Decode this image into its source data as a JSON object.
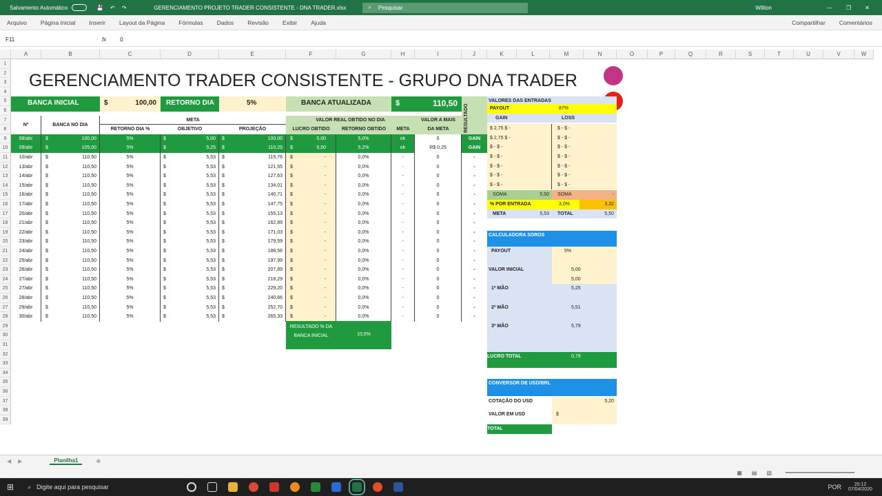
{
  "titlebar": {
    "autosave": "Salvamento Automático",
    "file_title": "GERENCIAMENTO PROJETO TRADER CONSISTENTE - DNA TRADER.xlsx",
    "search_placeholder": "Pesquisar",
    "user": "Willion"
  },
  "ribbon": {
    "tabs": [
      "Arquivo",
      "Página Inicial",
      "Inserir",
      "Layout da Página",
      "Fórmulas",
      "Dados",
      "Revisão",
      "Exibir",
      "Ajuda"
    ],
    "share": "Compartilhar",
    "comments": "Comentários"
  },
  "formulabar": {
    "cellref": "F11",
    "value": "0"
  },
  "columns": [
    "A",
    "B",
    "C",
    "D",
    "E",
    "F",
    "G",
    "H",
    "I",
    "J",
    "K",
    "L",
    "M",
    "N",
    "O",
    "P",
    "Q",
    "R",
    "S",
    "T",
    "U",
    "V",
    "W"
  ],
  "sheet": {
    "title": "GERENCIAMENTO TRADER CONSISTENTE - GRUPO DNA TRADER",
    "banca_inicial_label": "BANCA INICIAL",
    "banca_inicial_cur": "$",
    "banca_inicial_value": "100,00",
    "retorno_label": "RETORNO DIA",
    "retorno_value": "5%",
    "banca_atual_label": "BANCA ATUALIZADA",
    "banca_atual_cur": "$",
    "banca_atual_value": "110,50",
    "resultado_label": "RESULTADO",
    "h_num": "Nº",
    "h_banca": "BANCA NO DIA",
    "h_meta": "META",
    "h_retorno": "RETORNO DIA %",
    "h_objetivo": "OBJETIVO",
    "h_projecao": "PROJEÇÃO",
    "h_valor_real": "VALOR REAL OBTIDO NO DIA",
    "h_lucro": "LUCRO OBTIDO",
    "h_ret_obtido": "RETORNO OBTIDO",
    "h_meta2": "META",
    "h_valor_mais": "VALOR A MAIS",
    "h_da_meta": "DA META",
    "rows": [
      {
        "n": "9",
        "date": "08/abr",
        "banca": "100,00",
        "ret": "5%",
        "obj": "5,00",
        "proj": "100,00",
        "lucro": "5,00",
        "retob": "5,0%",
        "meta": "ok",
        "mais": "0",
        "res": "GAIN"
      },
      {
        "n": "10",
        "date": "09/abr",
        "banca": "105,00",
        "ret": "5%",
        "obj": "5,25",
        "proj": "110,25",
        "lucro": "5,50",
        "retob": "5,2%",
        "meta": "ok",
        "mais": "R$ 0,25",
        "res": "GAIN"
      },
      {
        "n": "11",
        "date": "10/abr",
        "banca": "110,50",
        "ret": "5%",
        "obj": "5,53",
        "proj": "115,76",
        "lucro": "-",
        "retob": "0,0%",
        "meta": "-",
        "mais": "0",
        "res": "-"
      },
      {
        "n": "12",
        "date": "13/abr",
        "banca": "110,50",
        "ret": "5%",
        "obj": "5,53",
        "proj": "121,55",
        "lucro": "-",
        "retob": "0,0%",
        "meta": "-",
        "mais": "0",
        "res": "-"
      },
      {
        "n": "13",
        "date": "14/abr",
        "banca": "110,50",
        "ret": "5%",
        "obj": "5,53",
        "proj": "127,63",
        "lucro": "-",
        "retob": "0,0%",
        "meta": "-",
        "mais": "0",
        "res": "-"
      },
      {
        "n": "14",
        "date": "15/abr",
        "banca": "110,50",
        "ret": "5%",
        "obj": "5,53",
        "proj": "134,01",
        "lucro": "-",
        "retob": "0,0%",
        "meta": "-",
        "mais": "0",
        "res": "-"
      },
      {
        "n": "15",
        "date": "16/abr",
        "banca": "110,50",
        "ret": "5%",
        "obj": "5,53",
        "proj": "140,71",
        "lucro": "-",
        "retob": "0,0%",
        "meta": "-",
        "mais": "0",
        "res": "-"
      },
      {
        "n": "16",
        "date": "17/abr",
        "banca": "110,50",
        "ret": "5%",
        "obj": "5,53",
        "proj": "147,75",
        "lucro": "-",
        "retob": "0,0%",
        "meta": "-",
        "mais": "0",
        "res": "-"
      },
      {
        "n": "17",
        "date": "20/abr",
        "banca": "110,50",
        "ret": "5%",
        "obj": "5,53",
        "proj": "155,13",
        "lucro": "-",
        "retob": "0,0%",
        "meta": "-",
        "mais": "0",
        "res": "-"
      },
      {
        "n": "18",
        "date": "21/abr",
        "banca": "110,50",
        "ret": "5%",
        "obj": "5,53",
        "proj": "162,89",
        "lucro": "-",
        "retob": "0,0%",
        "meta": "-",
        "mais": "0",
        "res": "-"
      },
      {
        "n": "19",
        "date": "22/abr",
        "banca": "110,50",
        "ret": "5%",
        "obj": "5,53",
        "proj": "171,03",
        "lucro": "-",
        "retob": "0,0%",
        "meta": "-",
        "mais": "0",
        "res": "-"
      },
      {
        "n": "20",
        "date": "23/abr",
        "banca": "110,50",
        "ret": "5%",
        "obj": "5,53",
        "proj": "179,59",
        "lucro": "-",
        "retob": "0,0%",
        "meta": "-",
        "mais": "0",
        "res": "-"
      },
      {
        "n": "21",
        "date": "24/abr",
        "banca": "110,50",
        "ret": "5%",
        "obj": "5,53",
        "proj": "188,56",
        "lucro": "-",
        "retob": "0,0%",
        "meta": "-",
        "mais": "0",
        "res": "-"
      },
      {
        "n": "22",
        "date": "25/abr",
        "banca": "110,50",
        "ret": "5%",
        "obj": "5,53",
        "proj": "197,99",
        "lucro": "-",
        "retob": "0,0%",
        "meta": "-",
        "mais": "0",
        "res": "-"
      },
      {
        "n": "23",
        "date": "26/abr",
        "banca": "110,50",
        "ret": "5%",
        "obj": "5,53",
        "proj": "207,89",
        "lucro": "-",
        "retob": "0,0%",
        "meta": "-",
        "mais": "0",
        "res": "-"
      },
      {
        "n": "24",
        "date": "27/abr",
        "banca": "110,50",
        "ret": "5%",
        "obj": "5,53",
        "proj": "218,29",
        "lucro": "-",
        "retob": "0,0%",
        "meta": "-",
        "mais": "0",
        "res": "-"
      },
      {
        "n": "25",
        "date": "27/abr",
        "banca": "110,50",
        "ret": "5%",
        "obj": "5,53",
        "proj": "229,20",
        "lucro": "-",
        "retob": "0,0%",
        "meta": "-",
        "mais": "0",
        "res": "-"
      },
      {
        "n": "26",
        "date": "28/abr",
        "banca": "110,50",
        "ret": "5%",
        "obj": "5,53",
        "proj": "240,66",
        "lucro": "-",
        "retob": "0,0%",
        "meta": "-",
        "mais": "0",
        "res": "-"
      },
      {
        "n": "27",
        "date": "29/abr",
        "banca": "110,50",
        "ret": "5%",
        "obj": "5,53",
        "proj": "252,70",
        "lucro": "-",
        "retob": "0,0%",
        "meta": "-",
        "mais": "0",
        "res": "-"
      },
      {
        "n": "28",
        "date": "30/abr",
        "banca": "110,50",
        "ret": "5%",
        "obj": "5,53",
        "proj": "265,33",
        "lucro": "-",
        "retob": "0,0%",
        "meta": "-",
        "mais": "0",
        "res": "-"
      }
    ],
    "resultado_box": "RESULTADO % DA BANCA INICIAL",
    "resultado_value": "10,5%",
    "entradas_title": "VALORES DAS ENTRADAS",
    "payout_label": "PAYOUT",
    "payout_value": "87%",
    "gain_label": "GAIN",
    "loss_label": "LOSS",
    "gain_vals": [
      "2,75",
      "2,75"
    ],
    "soma_label": "SOMA",
    "soma_gain": "5,50",
    "soma_loss": "-",
    "por_entrada_label": "% POR ENTRADA",
    "por_entrada_value": "3,0%",
    "por_entrada_amount": "3,32",
    "meta_label": "META",
    "meta_value": "5,53",
    "total_label": "TOTAL",
    "total_value": "5,50",
    "soros_title": "CALCULADORA SOROS",
    "soros_payout_label": "PAYOUT",
    "soros_payout": "5%",
    "valor_inicial_label": "VALOR INICIAL",
    "valor_inicial_1": "5,00",
    "valor_inicial_2": "5,00",
    "mao1_label": "1ª MÃO",
    "mao1": "5,25",
    "mao2_label": "2ª MÃO",
    "mao2": "5,51",
    "mao3_label": "3ª MÃO",
    "mao3": "5,79",
    "lucro_total_label": "LUCRO TOTAL",
    "lucro_total": "0,79",
    "conv_title": "CONVERSOR DE USD/BRL",
    "cot_label": "COTAÇÃO DO USD",
    "cot_value": "5,20",
    "valor_usd_label": "VALOR EM USD",
    "total2_label": "TOTAL"
  },
  "sheet_tab": "Planilha1",
  "taskbar": {
    "search": "Digite aqui para pesquisar",
    "time": "20:12",
    "date": "07/04/2020",
    "lang": "POR"
  }
}
